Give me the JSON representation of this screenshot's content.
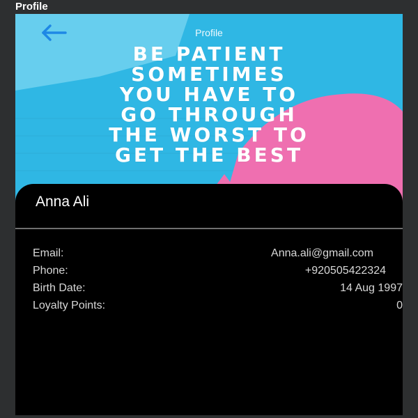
{
  "window": {
    "title": "Profile"
  },
  "header": {
    "title": "Profile"
  },
  "banner": {
    "quote_lines": [
      "BE PATIENT",
      "SOMETIMES",
      "YOU HAVE TO",
      "GO THROUGH",
      "THE WORST TO",
      "GET THE BEST"
    ],
    "colors": {
      "wall_blue": "#2fb7e4",
      "pink": "#ef6fb0",
      "light_blue": "#7fd7f2"
    }
  },
  "profile": {
    "name": "Anna Ali",
    "fields": [
      {
        "label": "Email:",
        "value": "Anna.ali@gmail.com"
      },
      {
        "label": "Phone:",
        "value": "+920505422324"
      },
      {
        "label": "Birth Date:",
        "value": "14 Aug 1997"
      },
      {
        "label": "Loyalty Points:",
        "value": "0"
      }
    ]
  },
  "icons": {
    "back": "arrow-left-icon"
  },
  "colors": {
    "accent": "#1e88e5",
    "background": "#000000",
    "divider": "#6f6f6f"
  }
}
